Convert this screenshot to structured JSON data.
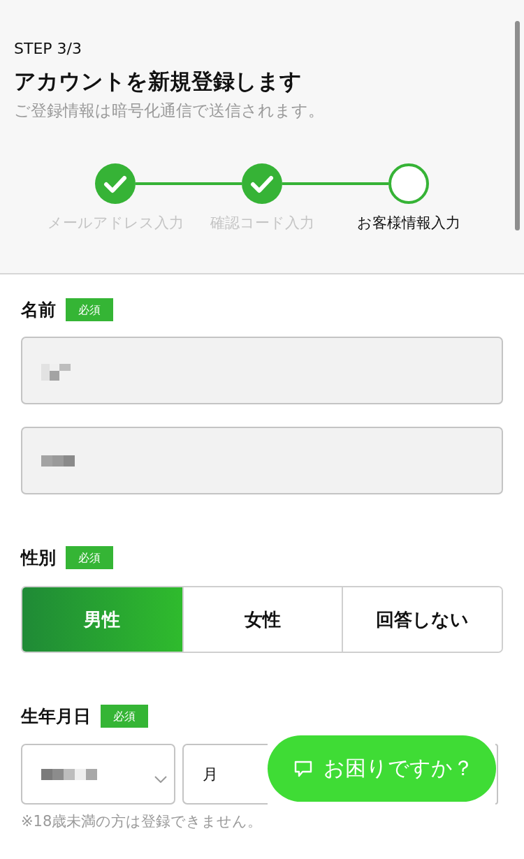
{
  "header": {
    "step": "STEP 3/3",
    "title": "アカウントを新規登録します",
    "subtitle": "ご登録情報は暗号化通信で送信されます。"
  },
  "stepper": [
    {
      "label": "メールアドレス入力",
      "done": true,
      "current": false
    },
    {
      "label": "確認コード入力",
      "done": true,
      "current": false
    },
    {
      "label": "お客様情報入力",
      "done": false,
      "current": true
    }
  ],
  "name": {
    "label": "名前",
    "badge": "必須",
    "fields": [
      {
        "masked": true
      },
      {
        "masked": true
      }
    ]
  },
  "gender": {
    "label": "性別",
    "badge": "必須",
    "options": [
      {
        "label": "男性",
        "selected": true
      },
      {
        "label": "女性",
        "selected": false
      },
      {
        "label": "回答しない",
        "selected": false
      }
    ]
  },
  "birthday": {
    "label": "生年月日",
    "badge": "必須",
    "selects": [
      {
        "masked": true
      },
      {
        "value": "月",
        "masked": false
      }
    ],
    "note": "※18歳未満の方は登録できません。"
  },
  "help_button": {
    "label": "お困りですか？"
  }
}
